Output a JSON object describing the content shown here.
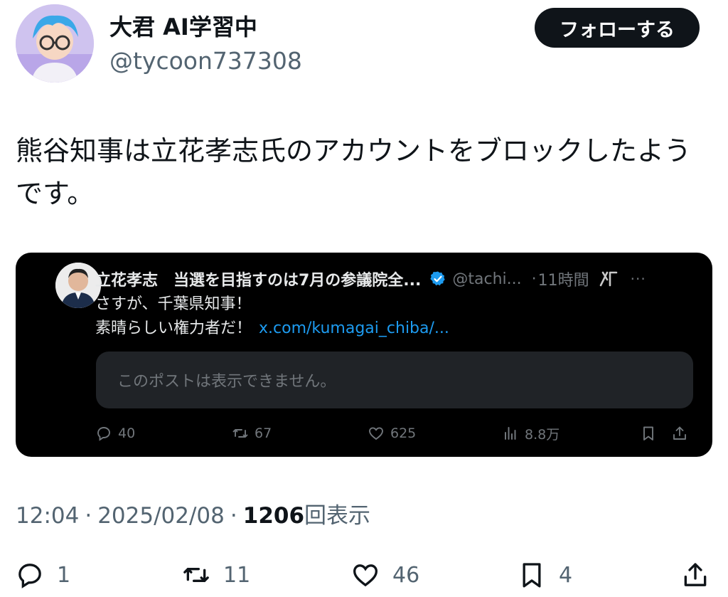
{
  "author": {
    "display_name": "大君 AI学習中",
    "handle": "@tycoon737308",
    "follow_label": "フォローする"
  },
  "tweet": {
    "text": "熊谷知事は立花孝志氏のアカウントをブロックしたようです。"
  },
  "quoted_post": {
    "name": "立花孝志　当選を目指すのは7月の参議院全...",
    "handle": "@tachi...",
    "dot": "·",
    "time": "11時間",
    "more": "···",
    "line1": "さすが、千葉県知事！",
    "line2": "素晴らしい権力者だ！",
    "link": "x.com/kumagai_chiba/...",
    "unavailable_text": "このポストは表示できません。",
    "replies": "40",
    "reposts": "67",
    "likes": "625",
    "views": "8.8万",
    "colors": {
      "background": "#000000",
      "link": "#1d9bf0",
      "verified": "#1d9bf0"
    }
  },
  "meta": {
    "time": "12:04",
    "sep": "·",
    "date": "2025/02/08",
    "views_count": "1206",
    "views_label": "回表示"
  },
  "actions": {
    "replies": "1",
    "reposts": "11",
    "likes": "46",
    "bookmarks": "4"
  },
  "icons": [
    "reply-icon",
    "repost-icon",
    "like-icon",
    "bookmark-icon",
    "share-icon",
    "views-icon",
    "verified-badge-icon",
    "grok-icon"
  ]
}
